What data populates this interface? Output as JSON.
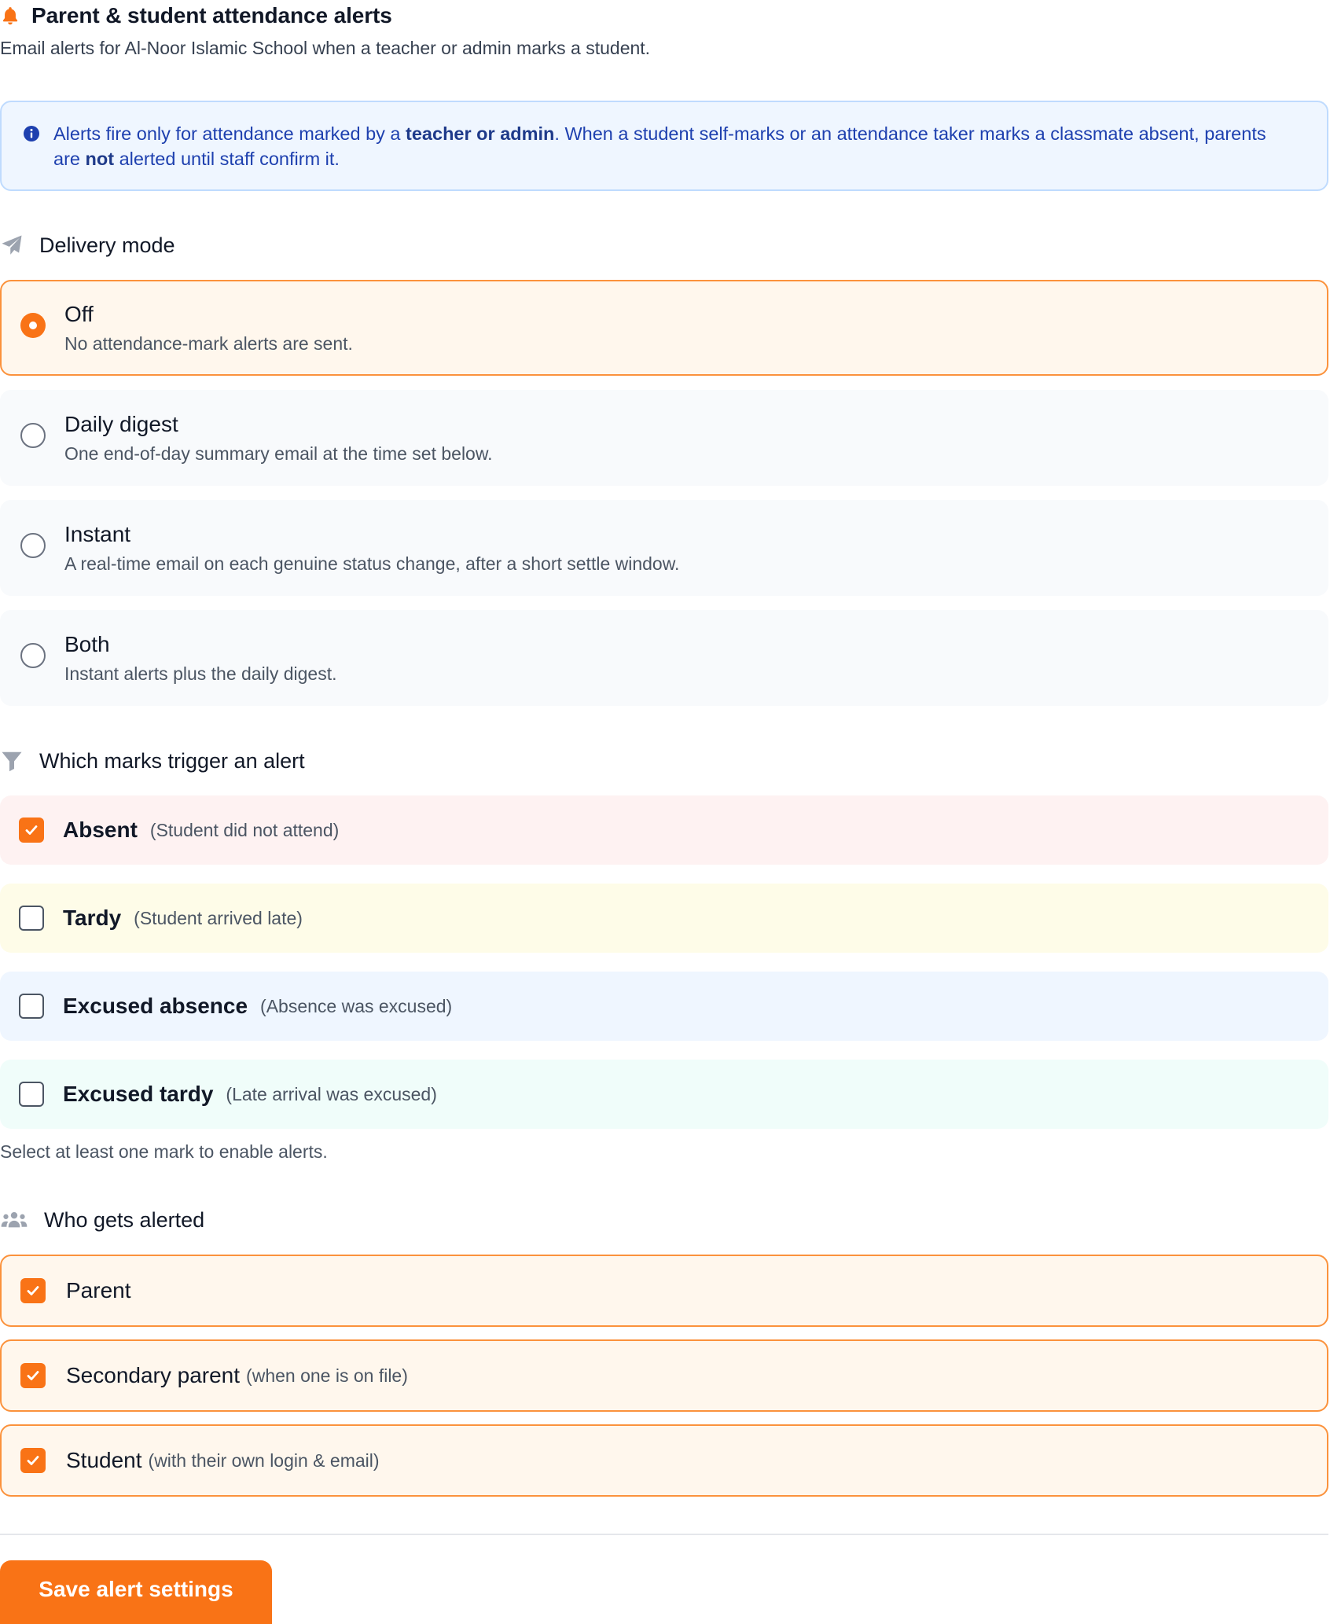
{
  "header": {
    "title": "Parent & student attendance alerts",
    "subtitle": "Email alerts for Al-Noor Islamic School when a teacher or admin marks a student.",
    "icon": "bell-icon"
  },
  "info": {
    "icon": "info-icon",
    "part1": "Alerts fire only for attendance marked by a ",
    "bold1": "teacher or admin",
    "part2": ". When a student self-marks or an attendance taker marks a classmate absent, parents are ",
    "bold2": "not",
    "part3": " alerted until staff confirm it."
  },
  "delivery": {
    "title": "Delivery mode",
    "icon": "paper-plane-icon",
    "selected": "off",
    "options": [
      {
        "id": "off",
        "label": "Off",
        "description": "No attendance-mark alerts are sent."
      },
      {
        "id": "daily",
        "label": "Daily digest",
        "description": "One end-of-day summary email at the time set below."
      },
      {
        "id": "instant",
        "label": "Instant",
        "description": "A real-time email on each genuine status change, after a short settle window."
      },
      {
        "id": "both",
        "label": "Both",
        "description": "Instant alerts plus the daily digest."
      }
    ]
  },
  "marks": {
    "title": "Which marks trigger an alert",
    "icon": "filter-icon",
    "items": [
      {
        "label": "Absent",
        "note": "(Student did not attend)",
        "checked": true
      },
      {
        "label": "Tardy",
        "note": "(Student arrived late)",
        "checked": false
      },
      {
        "label": "Excused absence",
        "note": "(Absence was excused)",
        "checked": false
      },
      {
        "label": "Excused tardy",
        "note": "(Late arrival was excused)",
        "checked": false
      }
    ],
    "hint": "Select at least one mark to enable alerts."
  },
  "recipients": {
    "title": "Who gets alerted",
    "icon": "users-icon",
    "items": [
      {
        "label": "Parent",
        "note": "",
        "checked": true
      },
      {
        "label": "Secondary parent",
        "note": "(when one is on file)",
        "checked": true
      },
      {
        "label": "Student",
        "note": "(with their own login & email)",
        "checked": true
      }
    ]
  },
  "actions": {
    "save_label": "Save alert settings"
  },
  "colors": {
    "accent": "#f97316",
    "info_bg": "#eff6ff",
    "info_text": "#1e40af"
  }
}
